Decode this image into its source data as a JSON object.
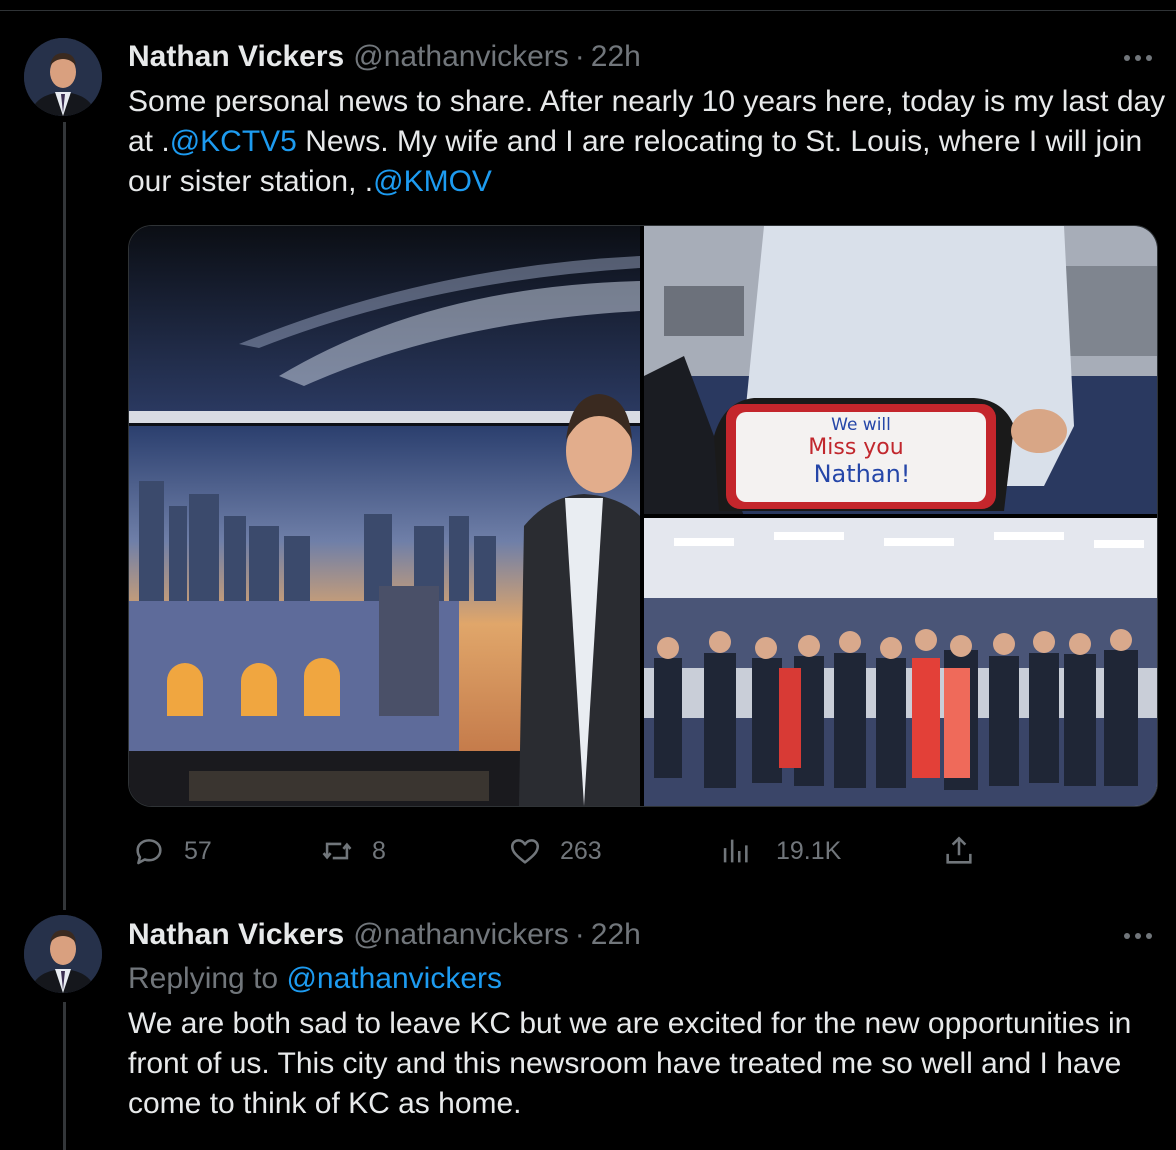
{
  "tweets": [
    {
      "author": {
        "name": "Nathan Vickers",
        "handle": "@nathanvickers"
      },
      "separator": "·",
      "time": "22h",
      "text": {
        "t1": "Some personal news to share. After nearly 10 years here, today is my last day at .",
        "m1": "@KCTV5",
        "t2": " News. My wife and I are relocating to St. Louis, where I will join our sister station, .",
        "m2": "@KMOV"
      },
      "media": [
        {
          "description": "Nathan in KCTV5 news studio with Kansas City skyline backdrop"
        },
        {
          "description": "Farewell cake",
          "cake_text": [
            "We will",
            "Miss you",
            "Nathan!"
          ]
        },
        {
          "description": "Newsroom staff group photo"
        }
      ],
      "metrics": {
        "replies": "57",
        "reposts": "8",
        "likes": "263",
        "views": "19.1K"
      }
    },
    {
      "author": {
        "name": "Nathan Vickers",
        "handle": "@nathanvickers"
      },
      "separator": "·",
      "time": "22h",
      "replying_label": "Replying to ",
      "replying_to": "@nathanvickers",
      "text": "We are both sad to leave KC but we are excited for the new opportunities in front of us. This city and this newsroom have treated me so well and I have come to think of KC as home."
    }
  ],
  "icons": {
    "more": "more-horizontal-icon",
    "reply": "reply-bubble-icon",
    "repost": "repost-icon",
    "like": "heart-icon",
    "views": "views-bar-chart-icon",
    "share": "share-upload-icon"
  },
  "colors": {
    "background": "#000000",
    "text": "#e7e9ea",
    "muted": "#71767b",
    "link": "#1d9bf0",
    "divider": "#2f3336"
  }
}
